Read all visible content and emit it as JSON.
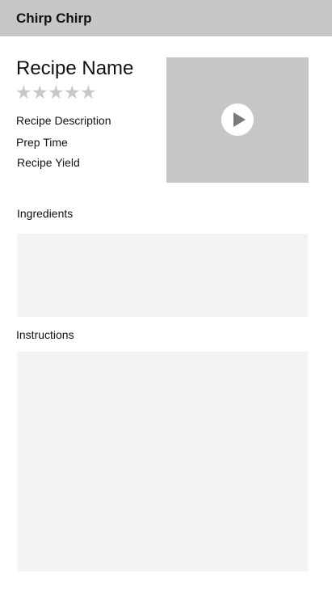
{
  "header": {
    "title": "Chirp Chirp"
  },
  "recipe": {
    "name": "Recipe Name",
    "rating_stars": [
      "★",
      "★",
      "★",
      "★",
      "★"
    ],
    "rating_value": 0,
    "rating_max": 5,
    "description_label": "Recipe Description",
    "prep_time_label": "Prep Time",
    "yield_label": "Recipe Yield"
  },
  "video": {
    "icon": "play-icon"
  },
  "sections": {
    "ingredients_label": "Ingredients",
    "instructions_label": "Instructions"
  },
  "colors": {
    "header_bg": "#c6c6c6",
    "star_empty": "#c8c8c8",
    "panel_bg": "#f3f3f3",
    "video_bg": "#c6c6c6"
  }
}
